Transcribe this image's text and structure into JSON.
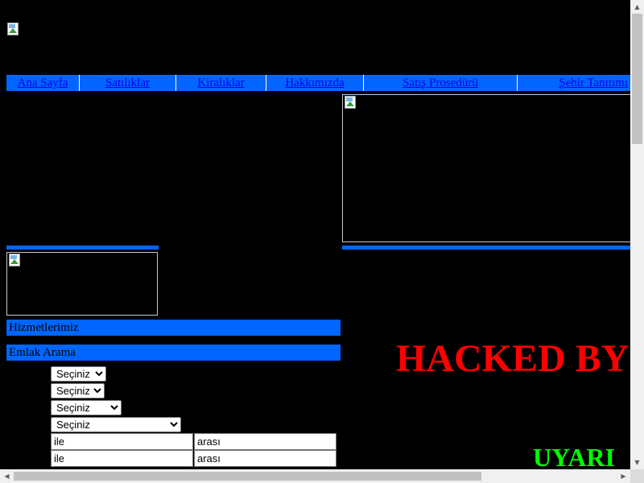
{
  "nav": {
    "items": [
      {
        "label": "Ana Sayfa"
      },
      {
        "label": "Satılıklar"
      },
      {
        "label": "Kiralıklar"
      },
      {
        "label": "Hakkımızda"
      },
      {
        "label": "Satış Prosedürü"
      },
      {
        "label": "Şehir Tanıtımı"
      }
    ]
  },
  "sections": {
    "services_title": "Hizmetlerimiz",
    "search_title": "Emlak Arama"
  },
  "search_form": {
    "select1": "Seçiniz",
    "select2": "Seçiniz",
    "select3": "Seçiniz",
    "select4": "Seçiniz",
    "range1_min": "ile",
    "range1_max": "arası",
    "range2_min": "ile",
    "range2_max": "arası"
  },
  "defacement": {
    "headline": "HACKED BY",
    "warning": "UYARI",
    "headline_color": "#ff0000",
    "warning_color": "#00ff00"
  },
  "theme": {
    "accent": "#0066ff",
    "background": "#000000",
    "link": "#0000ee"
  },
  "icons": {
    "broken_image": "broken-image-icon"
  }
}
